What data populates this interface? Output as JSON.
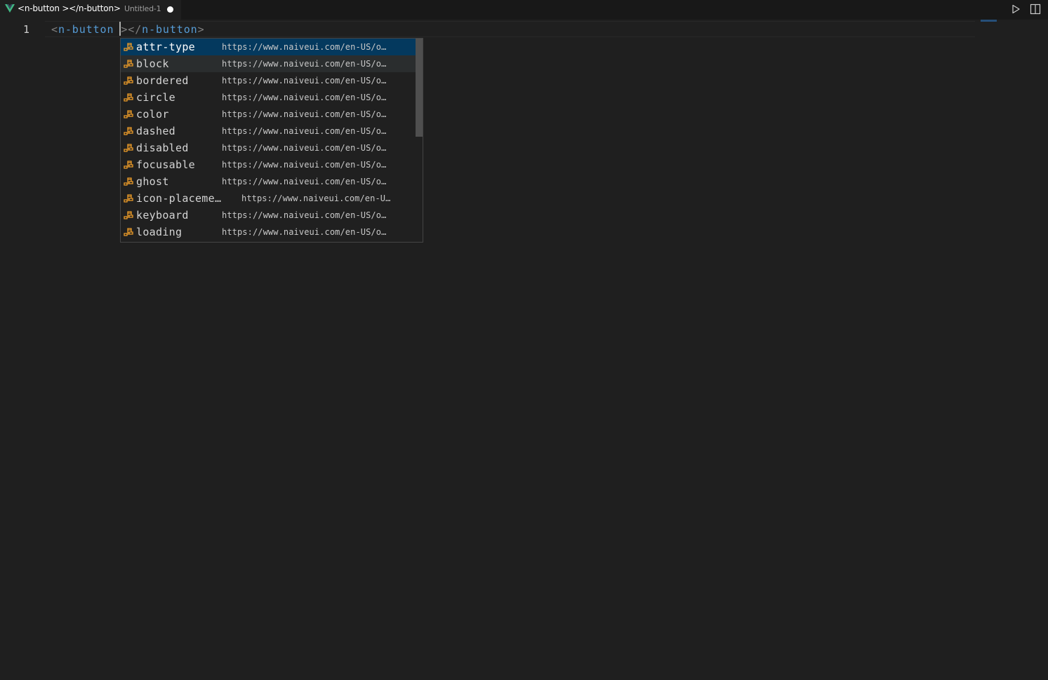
{
  "tab": {
    "title": "<n-button ></n-button>",
    "description": "Untitled-1",
    "icon": "vue-logo-icon",
    "dirty": true
  },
  "actions": {
    "run_icon": "play-icon",
    "split_icon": "split-editor-icon"
  },
  "editor": {
    "line_number": "1",
    "tokens": {
      "open_bracket": "<",
      "open_tag": "n-button",
      "space": " ",
      "close_bracket_1": ">",
      "close_open": "</",
      "close_tag": "n-button",
      "close_bracket_2": ">"
    }
  },
  "suggest": {
    "item_icon": "property-icon",
    "items": [
      {
        "label": "attr-type",
        "detail": "https://www.naiveui.com/en-US/o…"
      },
      {
        "label": "block",
        "detail": "https://www.naiveui.com/en-US/o…"
      },
      {
        "label": "bordered",
        "detail": "https://www.naiveui.com/en-US/o…"
      },
      {
        "label": "circle",
        "detail": "https://www.naiveui.com/en-US/o…"
      },
      {
        "label": "color",
        "detail": "https://www.naiveui.com/en-US/o…"
      },
      {
        "label": "dashed",
        "detail": "https://www.naiveui.com/en-US/o…"
      },
      {
        "label": "disabled",
        "detail": "https://www.naiveui.com/en-US/o…"
      },
      {
        "label": "focusable",
        "detail": "https://www.naiveui.com/en-US/o…"
      },
      {
        "label": "ghost",
        "detail": "https://www.naiveui.com/en-US/o…"
      },
      {
        "label": "icon-placeme…",
        "detail": "https://www.naiveui.com/en-U…"
      },
      {
        "label": "keyboard",
        "detail": "https://www.naiveui.com/en-US/o…"
      },
      {
        "label": "loading",
        "detail": "https://www.naiveui.com/en-US/o…"
      }
    ]
  },
  "colors": {
    "editor_bg": "#1f1f1f",
    "selection": "#04395e",
    "icon_orange": "#ee9d28",
    "tag_blue": "#569cd6",
    "vue_green": "#41b883"
  }
}
